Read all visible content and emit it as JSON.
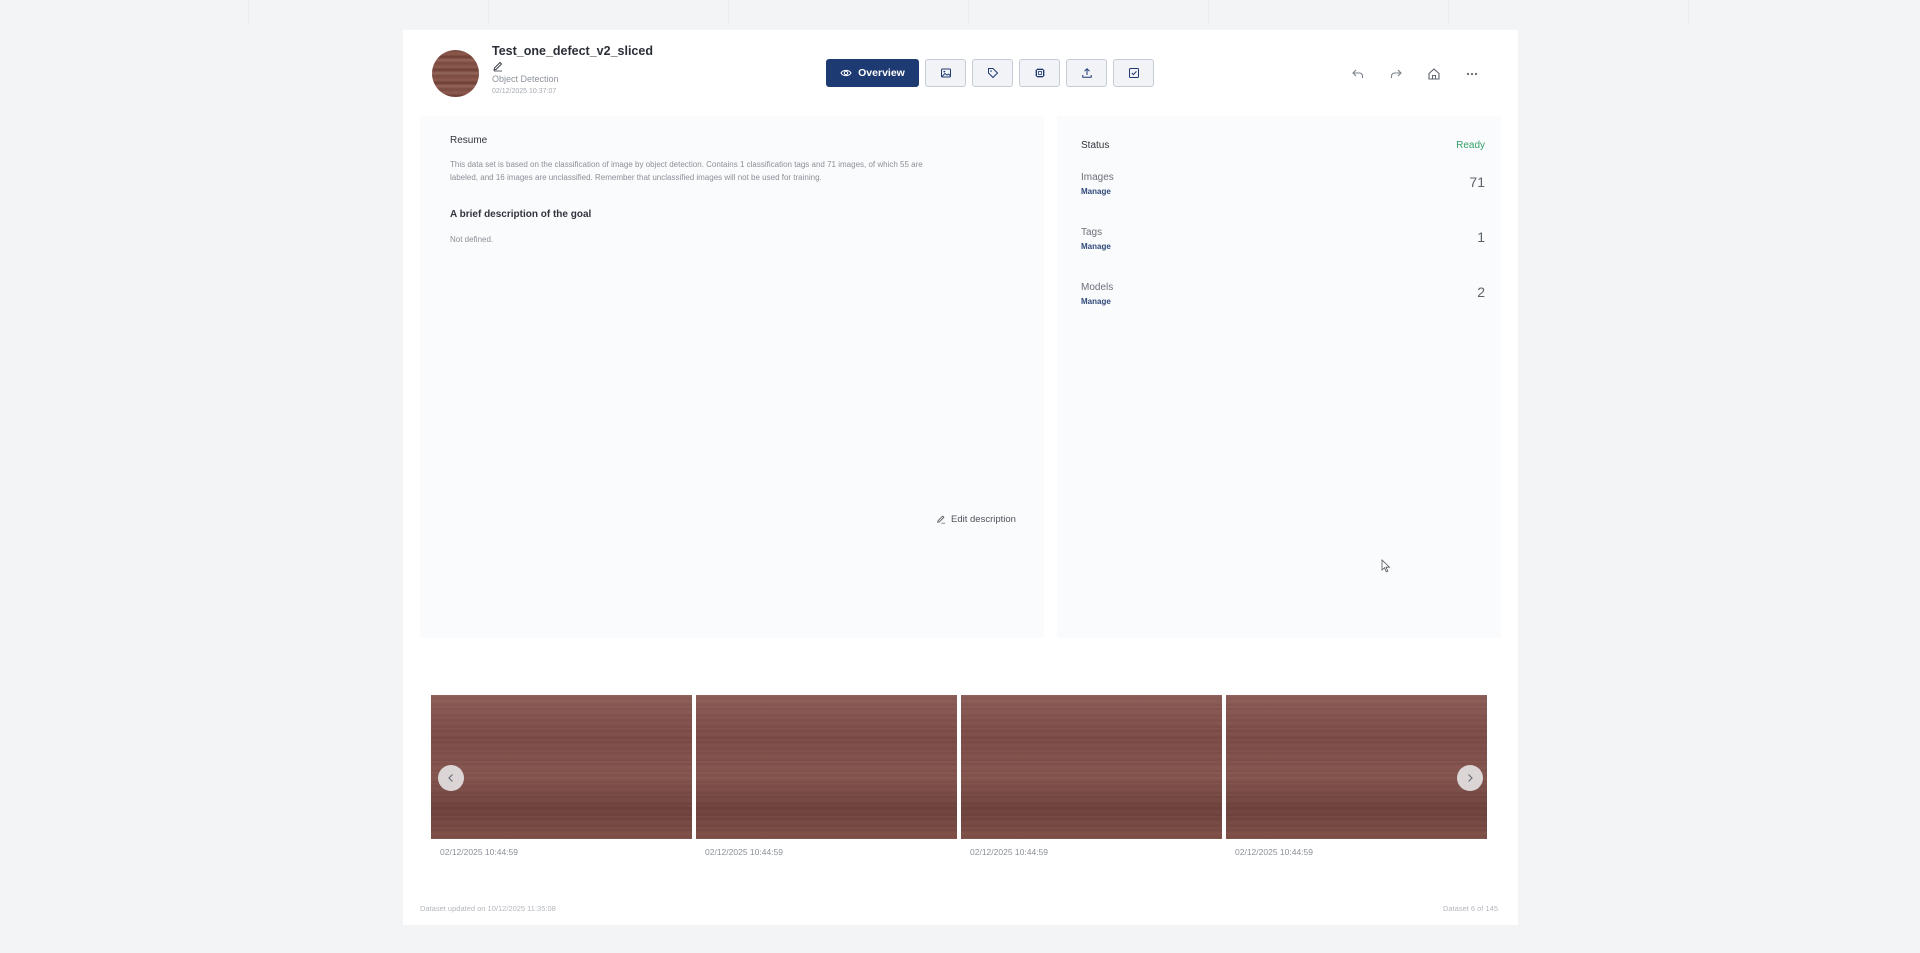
{
  "dataset": {
    "title": "Test_one_defect_v2_sliced",
    "type": "Object Detection",
    "created": "02/12/2025 10:37:07"
  },
  "tabs": [
    {
      "label": "Overview",
      "icon": "eye-icon",
      "active": true
    },
    {
      "label": "",
      "icon": "image-icon"
    },
    {
      "label": "",
      "icon": "tag-icon"
    },
    {
      "label": "",
      "icon": "model-icon"
    },
    {
      "label": "",
      "icon": "upload-icon"
    },
    {
      "label": "",
      "icon": "checklist-icon"
    }
  ],
  "toolbar_icons": [
    "undo-icon",
    "redo-icon",
    "home-icon",
    "more-icon"
  ],
  "resume": {
    "heading": "Resume",
    "text_line1": "This data set is based on the classification of image by object detection. Contains 1 classification tags and 71 images, of which 55 are",
    "text_line2": "labeled, and 16 images are unclassified. Remember that unclassified images will not be used for training.",
    "goal_heading": "A brief description of the goal",
    "goal_text": "Not defined.",
    "edit_label": "Edit description"
  },
  "status": {
    "label": "Status",
    "value": "Ready",
    "stats": [
      {
        "label": "Images",
        "manage": "Manage",
        "value": "71"
      },
      {
        "label": "Tags",
        "manage": "Manage",
        "value": "1"
      },
      {
        "label": "Models",
        "manage": "Manage",
        "value": "2"
      }
    ]
  },
  "gallery": [
    {
      "date": "02/12/2025 10:44:59"
    },
    {
      "date": "02/12/2025 10:44:59"
    },
    {
      "date": "02/12/2025 10:44:59"
    },
    {
      "date": "02/12/2025 10:44:59"
    }
  ],
  "footer": {
    "updated": "Dataset updated on 10/12/2025 11:35:08",
    "position": "Dataset 6 of 145"
  },
  "colors": {
    "accent": "#1e3a73",
    "ready": "#34a16a",
    "manage": "#2f4a7a"
  }
}
